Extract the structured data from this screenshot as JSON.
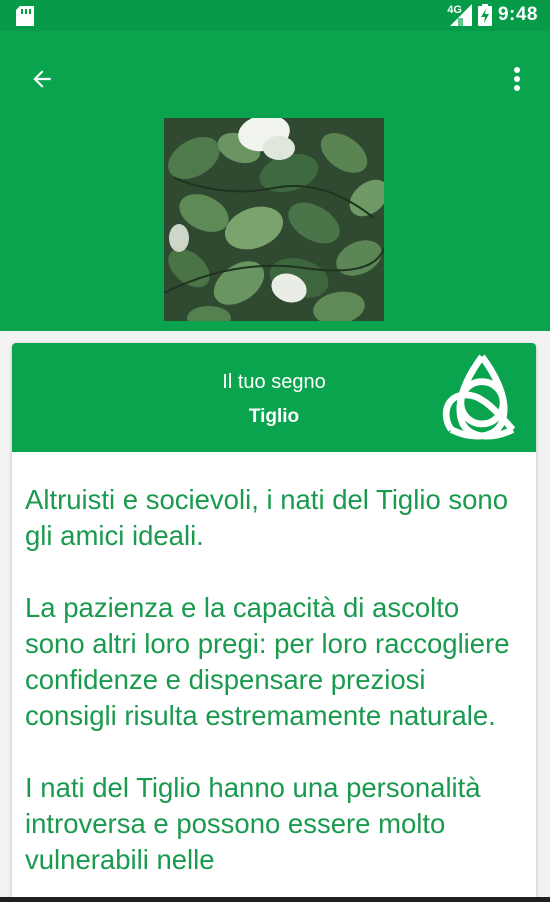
{
  "status_bar": {
    "network": "4G",
    "time": "9:48"
  },
  "app_bar": {
    "back_icon": "arrow-left-icon",
    "menu_icon": "more-vert-icon",
    "image_subject": "leaves-photo"
  },
  "card": {
    "header_label": "Il tuo segno",
    "sign_name": "Tiglio",
    "emblem_icon": "triquetra-icon",
    "paragraphs": [
      "Altruisti e socievoli, i nati del Tiglio sono gli amici ideali.",
      "La pazienza e la capacità di ascolto sono altri loro pregi: per loro raccogliere confidenze e dispensare preziosi consigli risulta estremamente naturale.",
      "I nati del Tiglio hanno una personalità introversa e possono essere molto vulnerabili nelle"
    ]
  },
  "colors": {
    "status_bar": "#059b48",
    "primary": "#0aa44f",
    "body_text": "#1a9a4e"
  }
}
